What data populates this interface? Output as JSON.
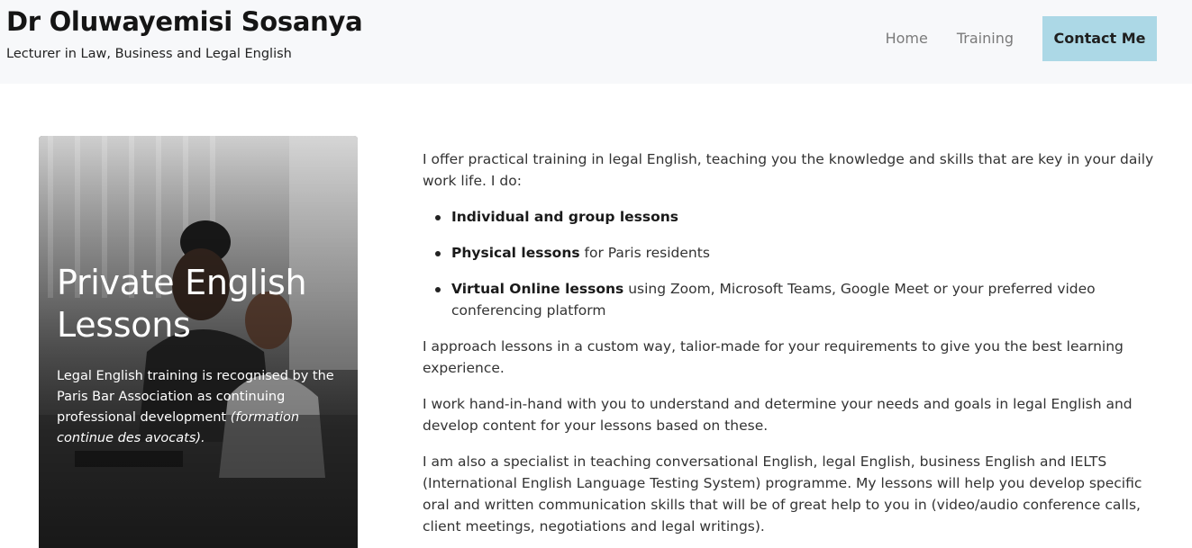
{
  "header": {
    "site_title": "Dr Oluwayemisi Sosanya",
    "tagline": "Lecturer in Law, Business and Legal English",
    "nav": {
      "home": "Home",
      "training": "Training",
      "contact": "Contact Me"
    },
    "accent_color": "#acd8e6"
  },
  "hero": {
    "title": "Private English Lessons",
    "text": "Legal English training is recognised by the Paris Bar Association as continuing professional development",
    "text_italic": "(formation continue des avocats)."
  },
  "main": {
    "intro": "I offer practical training in legal English, teaching you the knowledge and skills that are key in your daily work life. I do:",
    "services": [
      {
        "bold": "Individual and group lessons",
        "rest": ""
      },
      {
        "bold": "Physical lessons",
        "rest": " for Paris residents"
      },
      {
        "bold": "Virtual Online lessons",
        "rest": " using Zoom, Microsoft Teams, Google Meet or your preferred video conferencing platform"
      }
    ],
    "paragraphs": [
      "I approach lessons in a custom way, talior-made for your requirements to give you the best learning experience.",
      "I work hand-in-hand with you to understand and determine your needs and goals in legal English and develop content for your lessons based on these.",
      "I am also a specialist in teaching conversational English, legal English, business English and IELTS (International English Language Testing System) programme. My lessons will help you develop specific oral and written communication skills that will be of great help to you in (video/audio conference calls, client meetings, negotiations and legal writings)."
    ]
  }
}
